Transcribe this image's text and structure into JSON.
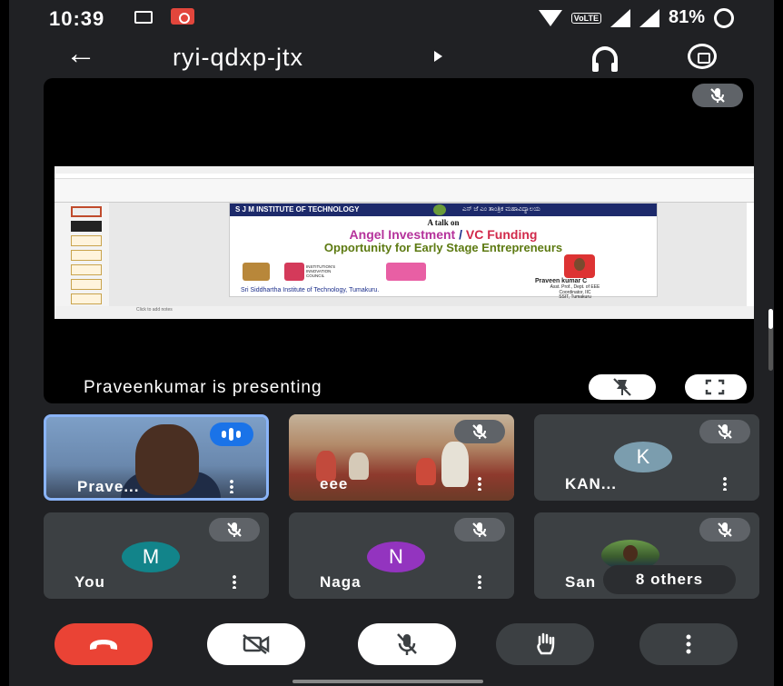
{
  "status_bar": {
    "time": "10:39",
    "volte": "VoLTE",
    "battery": "81%"
  },
  "header": {
    "meeting_code": "ryi-qdxp-jtx"
  },
  "presentation": {
    "label": "Praveenkumar is presenting",
    "slide": {
      "institute": "S J M INSTITUTE OF TECHNOLOGY",
      "kannada": "ಎಸ್ ಜೆ ಎಂ ತಾಂತ್ರಿಕ ಮಹಾವಿದ್ಯಾಲಯ",
      "talk_on": "A talk on",
      "title_part1": "Angel Investment",
      "title_sep": " / ",
      "title_part2": "VC Funding",
      "subtitle": "Opportunity for Early Stage Entrepreneurs",
      "iic": "INSTITUTION'S INNOVATION COUNCIL",
      "presenter_name": "Praveen kumar C",
      "presenter_desig": "Asst. Prof., Dept. of EEE",
      "presenter_role": "Coordinator, IIC",
      "presenter_org": "SSIT, Tumakuru",
      "college": "Sri Siddhartha Institute of Technology, Tumakuru.",
      "notes": "Click to add notes"
    }
  },
  "participants": [
    {
      "name": "Prave...",
      "speaking": true
    },
    {
      "name": "eee",
      "muted": true
    },
    {
      "name": "KAN...",
      "initial": "K",
      "color": "#7b9dae",
      "muted": true
    },
    {
      "name": "You",
      "initial": "M",
      "color": "#12848a",
      "muted": true
    },
    {
      "name": "Naga",
      "initial": "N",
      "color": "#9334bf",
      "muted": true
    },
    {
      "name": "San",
      "others_label": "8 others",
      "muted": true
    }
  ],
  "controls": [
    "end-call",
    "camera-off",
    "mic-off",
    "raise-hand",
    "more-options"
  ]
}
